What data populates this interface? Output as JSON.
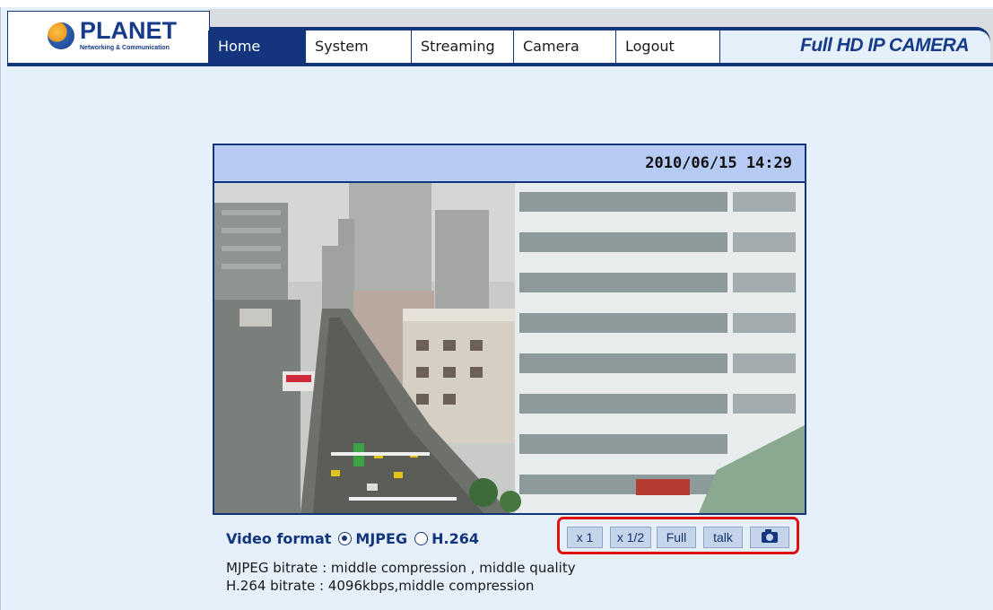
{
  "header": {
    "logo_text": "PLANET",
    "logo_subtext": "Networking & Communication",
    "brand": "Full HD IP CAMERA",
    "nav": [
      {
        "label": "Home",
        "active": true
      },
      {
        "label": "System"
      },
      {
        "label": "Streaming"
      },
      {
        "label": "Camera"
      },
      {
        "label": "Logout"
      }
    ]
  },
  "video": {
    "timestamp": "2010/06/15 14:29"
  },
  "controls": {
    "format_label": "Video format",
    "formats": [
      {
        "label": "MJPEG",
        "checked": true
      },
      {
        "label": "H.264",
        "checked": false
      }
    ],
    "buttons": {
      "x1": "x 1",
      "x12": "x 1/2",
      "full": "Full",
      "talk": "talk",
      "snapshot_icon": "camera-icon"
    }
  },
  "bitrate": {
    "mjpeg": "MJPEG bitrate : middle compression , middle quality",
    "h264": "H.264 bitrate : 4096kbps,middle compression"
  },
  "colors": {
    "nav_blue": "#12357e",
    "page_bg": "#e6f0fb",
    "time_bar": "#b6cbf4",
    "highlight_red": "#e01010"
  }
}
